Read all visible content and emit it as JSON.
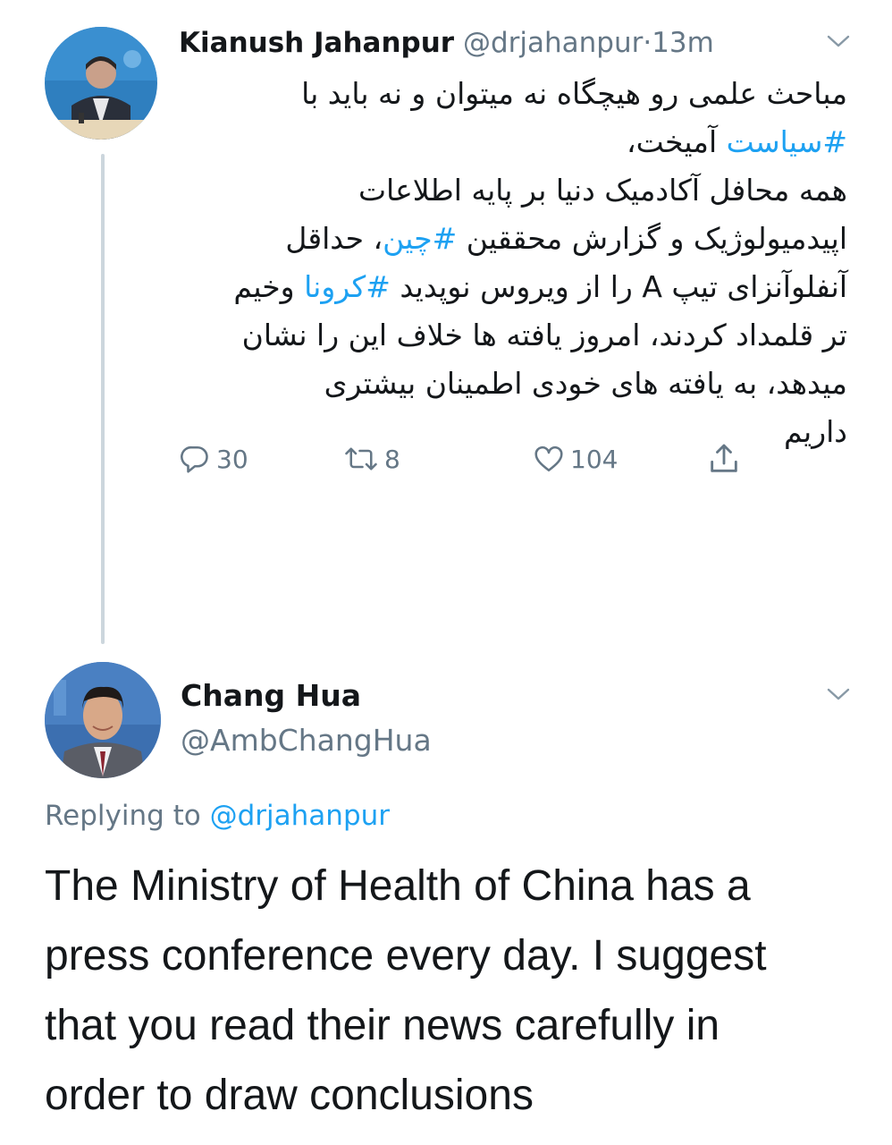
{
  "tweet": {
    "author_name": "Kianush Jahanpur",
    "author_handle": "@drjahanpur",
    "separator": "·",
    "time": "13m",
    "text_lines": [
      [
        {
          "t": "مباحث علمی رو هیچگاه نه میتوان و نه باید با",
          "link": false
        }
      ],
      [
        {
          "t": "#سیاست",
          "link": true
        },
        {
          "t": " آمیخت،",
          "link": false
        }
      ],
      [
        {
          "t": "همه محافل آکادمیک دنیا بر پایه اطلاعات",
          "link": false
        }
      ],
      [
        {
          "t": "اپیدمیولوژیک و گزارش محققین ",
          "link": false
        },
        {
          "t": "#چین",
          "link": true
        },
        {
          "t": "، حداقل",
          "link": false
        }
      ],
      [
        {
          "t": "آنفلوآنزای تیپ A را از ویروس نوپدید ",
          "link": false
        },
        {
          "t": "#کرونا",
          "link": true
        },
        {
          "t": " وخیم",
          "link": false
        }
      ],
      [
        {
          "t": "تر قلمداد کردند، امروز یافته ها خلاف این را نشان",
          "link": false
        }
      ],
      [
        {
          "t": "میدهد، به یافته های خودی اطمینان بیشتری",
          "link": false
        }
      ],
      [
        {
          "t": "داریم",
          "link": false
        }
      ]
    ],
    "reply_count": "30",
    "retweet_count": "8",
    "like_count": "104",
    "icons": {
      "reply": "reply-icon",
      "retweet": "retweet-icon",
      "like": "heart-icon",
      "share": "share-icon",
      "menu": "chevron-down-icon"
    }
  },
  "reply": {
    "author_name": "Chang Hua",
    "author_handle": "@AmbChangHua",
    "replying_prefix": "Replying to ",
    "replying_to": "@drjahanpur",
    "text_lines": [
      "The Ministry of Health of China has a",
      "press conference every day. I suggest",
      "that you read their news carefully in",
      "order to draw conclusions"
    ]
  },
  "colors": {
    "link": "#1da1f2",
    "muted": "#657786",
    "text": "#14171a",
    "thread_line": "#ccd6dd"
  }
}
